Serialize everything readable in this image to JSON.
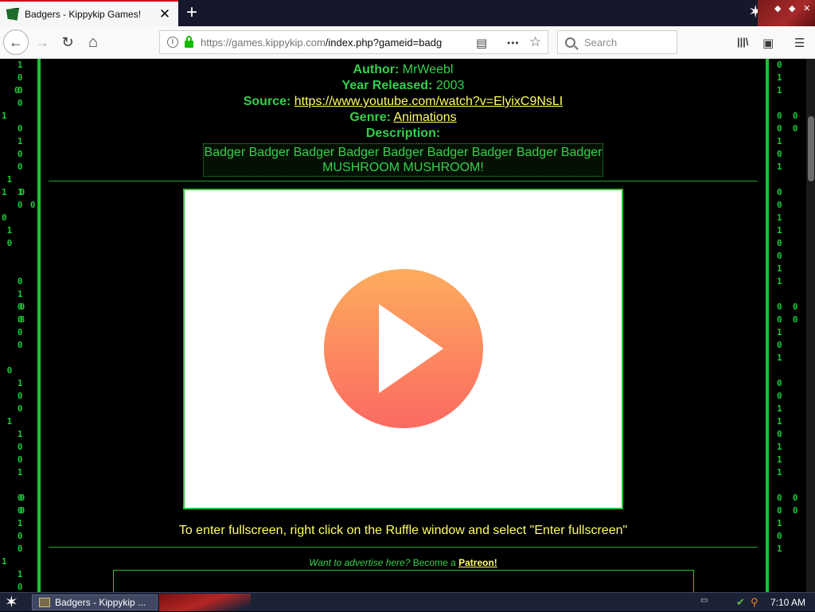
{
  "browser": {
    "tab": {
      "title": "Badgers - Kippykip Games!",
      "close_label": "✕"
    },
    "new_tab_label": "+",
    "window_controls": [
      "◆",
      "◆",
      "✕"
    ],
    "nav": {
      "back_icon": "←",
      "forward_icon": "→",
      "reload_icon": "↻",
      "home_icon": "⌂"
    },
    "url": {
      "host": "https://games.kippykip.com",
      "path": "/index.php?gameid=badg"
    },
    "url_icons": {
      "reader": "▤",
      "more": "•••",
      "bookmark": "☆"
    },
    "search": {
      "placeholder": "Search"
    },
    "toolbar_icons": {
      "library": "|||\\",
      "sidebar": "▣",
      "menu": "☰"
    }
  },
  "page": {
    "meta": {
      "author_key": "Author:",
      "author_val": "MrWeebl",
      "year_key": "Year Released:",
      "year_val": "2003",
      "source_key": "Source:",
      "source_link": "https://www.youtube.com/watch?v=ElyixC9NsLI",
      "genre_key": "Genre:",
      "genre_link": "Animations",
      "desc_key": "Description:",
      "description": "Badger Badger Badger Badger Badger Badger Badger Badger Badger MUSHROOM MUSHROOM!"
    },
    "fullscreen_hint": "To enter fullscreen, right click on the Ruffle window and select \"Enter fullscreen\"",
    "advert": {
      "question": "Want to advertise here?",
      "become": "Become a",
      "link": "Patreon!"
    }
  },
  "taskbar": {
    "start_icon": "✶",
    "task_label": "Badgers - Kippykip ...",
    "clock": "7:10 AM"
  },
  "colors": {
    "accent_green": "#33d14b",
    "link_yellow": "#ffff66",
    "play_top": "#fdac5d",
    "play_bottom": "#fb6a62"
  }
}
